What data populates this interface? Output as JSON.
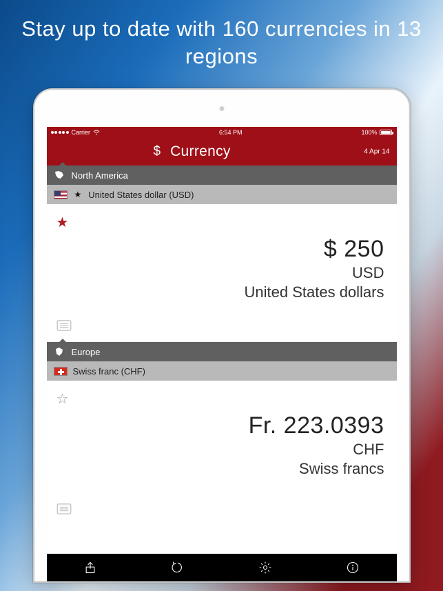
{
  "tagline": "Stay up to date with 160 currencies in 13 regions",
  "status": {
    "carrier": "Carrier",
    "time": "6:54 PM",
    "battery_pct": "100%"
  },
  "nav": {
    "symbol": "$",
    "title": "Currency",
    "date": "4 Apr 14"
  },
  "regions": [
    {
      "name": "North America",
      "currency_row": "United States dollar (USD)",
      "favorite": true,
      "amount_display": "$ 250",
      "code": "USD",
      "long_name": "United States dollars"
    },
    {
      "name": "Europe",
      "currency_row": "Swiss franc (CHF)",
      "favorite": false,
      "amount_display": "Fr. 223.0393",
      "code": "CHF",
      "long_name": "Swiss francs"
    }
  ],
  "icons": {
    "star_filled": "★",
    "star_hollow": "☆"
  }
}
